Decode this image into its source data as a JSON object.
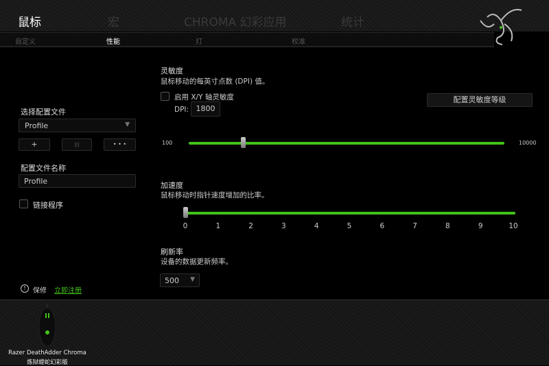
{
  "tabs": [
    "鼠标",
    "宏",
    "CHROMA 幻彩应用",
    "统计"
  ],
  "subtabs": [
    "自定义",
    "性能",
    "灯",
    "校准"
  ],
  "left": {
    "profile_label": "选择配置文件",
    "profile_value": "Profile",
    "add": "+",
    "delete": "|||",
    "more": "• • •",
    "name_label": "配置文件名称",
    "name_value": "Profile",
    "link_label": "链接程序",
    "warranty": "保修",
    "register": "立即注册"
  },
  "sensitivity": {
    "title": "灵敏度",
    "desc": "鼠标移动的每英寸点数 (DPI) 值。",
    "xy_label": "启用 X/Y 轴灵敏度",
    "dpi_label": "DPI:",
    "dpi_value": "1800",
    "stages_button": "配置灵敏度等级",
    "min": "100",
    "max": "10000",
    "value": 1800
  },
  "acceleration": {
    "title": "加速度",
    "desc": "鼠标移动时指针速度增加的比率。",
    "ticks": [
      "0",
      "1",
      "2",
      "3",
      "4",
      "5",
      "6",
      "7",
      "8",
      "9",
      "10"
    ],
    "value": 0
  },
  "polling": {
    "title": "刷新率",
    "desc": "设备的数据更新频率。",
    "value": "500"
  },
  "device": {
    "name": "Razer DeathAdder Chroma",
    "name_cn": "炼狱蝰蛇幻彩版"
  },
  "colors": {
    "accent": "#44c21c"
  }
}
